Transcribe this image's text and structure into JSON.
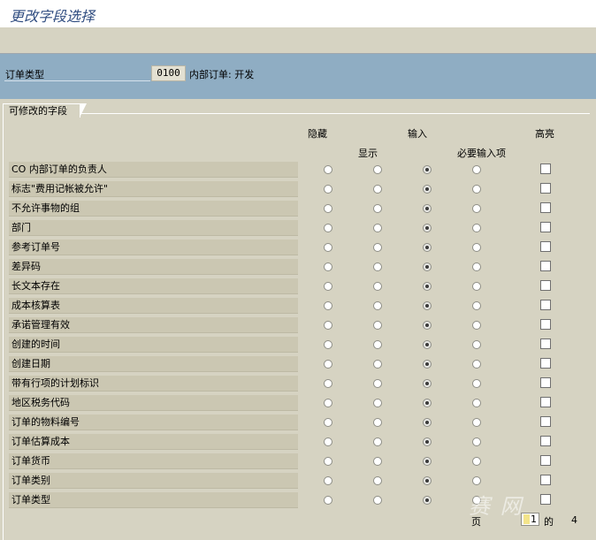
{
  "window": {
    "title": "更改字段选择"
  },
  "header": {
    "order_type_label": "订单类型",
    "order_type_value": "0100",
    "order_type_desc": "内部订单: 开发"
  },
  "group": {
    "tab_label": "可修改的字段"
  },
  "columns": {
    "hide": "隐藏",
    "display": "显示",
    "input": "输入",
    "required": "必要输入项",
    "highlight": "高亮"
  },
  "rows": [
    {
      "label": "CO 内部订单的负责人"
    },
    {
      "label": "标志\"费用记帐被允许\""
    },
    {
      "label": "不允许事物的组"
    },
    {
      "label": "部门"
    },
    {
      "label": "参考订单号"
    },
    {
      "label": "差异码"
    },
    {
      "label": "长文本存在"
    },
    {
      "label": "成本核算表"
    },
    {
      "label": "承诺管理有效"
    },
    {
      "label": "创建的时间"
    },
    {
      "label": "创建日期"
    },
    {
      "label": "带有行项的计划标识"
    },
    {
      "label": "地区税务代码"
    },
    {
      "label": "订单的物料编号"
    },
    {
      "label": "订单估算成本"
    },
    {
      "label": "订单货币"
    },
    {
      "label": "订单类别"
    },
    {
      "label": "订单类型"
    }
  ],
  "pager": {
    "page_label": "页",
    "current": "1",
    "of_label": "的",
    "total": "4"
  },
  "watermark": {
    "text": "赛 网"
  }
}
